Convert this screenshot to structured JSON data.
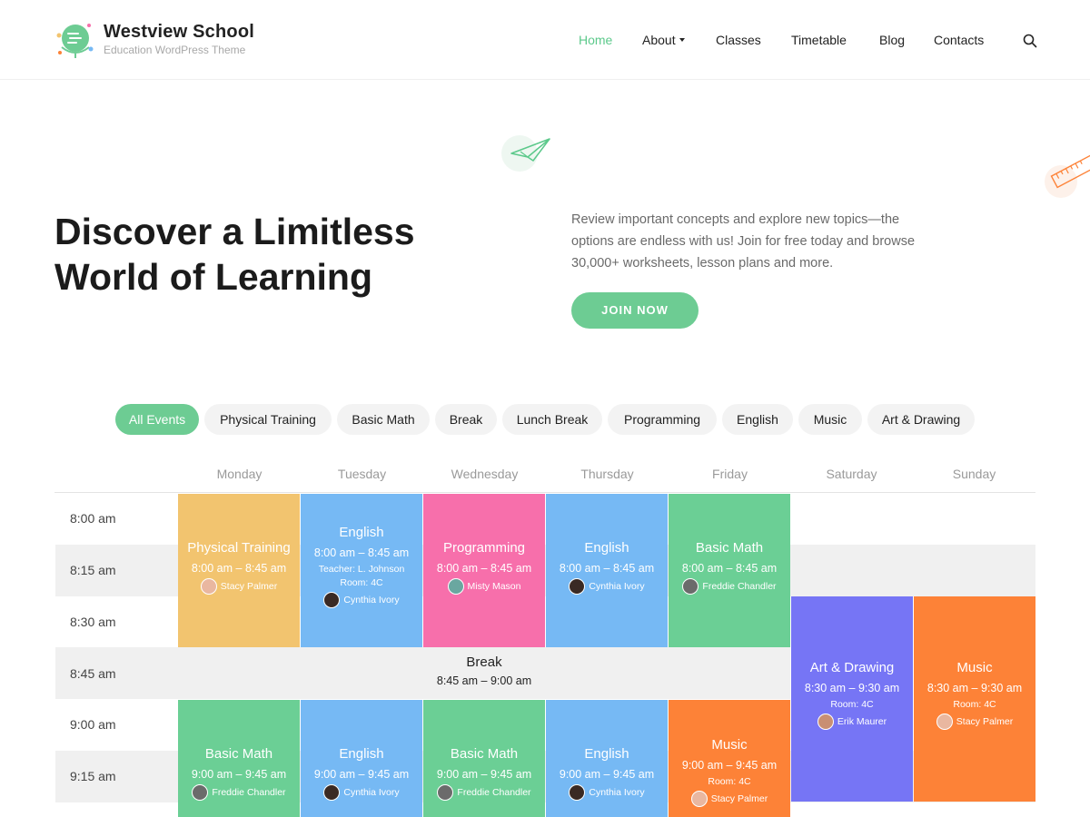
{
  "brand": {
    "title": "Westview School",
    "tagline": "Education WordPress Theme"
  },
  "nav": [
    {
      "label": "Home",
      "active": true
    },
    {
      "label": "About",
      "dropdown": true
    },
    {
      "label": "Classes"
    },
    {
      "label": "Timetable"
    },
    {
      "label": "Blog"
    },
    {
      "label": "Contacts"
    }
  ],
  "hero": {
    "title": "Discover a Limitless World of Learning",
    "text": "Review important concepts and explore new topics—the options are endless with us! Join for free today and browse 30,000+ worksheets, lesson plans and more.",
    "cta": "JOIN NOW"
  },
  "filters": [
    "All Events",
    "Physical Training",
    "Basic Math",
    "Break",
    "Lunch Break",
    "Programming",
    "English",
    "Music",
    "Art & Drawing"
  ],
  "days": [
    "Monday",
    "Tuesday",
    "Wednesday",
    "Thursday",
    "Friday",
    "Saturday",
    "Sunday"
  ],
  "times": [
    "8:00 am",
    "8:15 am",
    "8:30 am",
    "8:45 am",
    "9:00 am",
    "9:15 am"
  ],
  "events": [
    {
      "title": "Physical Training",
      "time": "8:00 am – 8:45 am",
      "person": "Stacy Palmer",
      "color": "#f2c46f"
    },
    {
      "title": "English",
      "time": "8:00 am – 8:45 am",
      "teacher": "Teacher: L. Johnson",
      "room": "Room: 4C",
      "person": "Cynthia Ivory",
      "color": "#76b9f4"
    },
    {
      "title": "Programming",
      "time": "8:00 am – 8:45 am",
      "person": "Misty Mason",
      "color": "#f76fab"
    },
    {
      "title": "English",
      "time": "8:00 am – 8:45 am",
      "person": "Cynthia Ivory",
      "color": "#76b9f4"
    },
    {
      "title": "Basic Math",
      "time": "8:00 am – 8:45 am",
      "person": "Freddie Chandler",
      "color": "#6bcf95"
    },
    {
      "title": "Art & Drawing",
      "time": "8:30 am – 9:30 am",
      "room": "Room: 4C",
      "person": "Erik Maurer",
      "color": "#7675f5"
    },
    {
      "title": "Music",
      "time": "8:30 am – 9:30 am",
      "room": "Room: 4C",
      "person": "Stacy Palmer",
      "color": "#fd8237"
    },
    {
      "title": "Break",
      "time": "8:45 am – 9:00 am"
    },
    {
      "title": "Basic Math",
      "time": "9:00 am – 9:45 am",
      "person": "Freddie Chandler",
      "color": "#6bcf95"
    },
    {
      "title": "English",
      "time": "9:00 am – 9:45 am",
      "person": "Cynthia Ivory",
      "color": "#76b9f4"
    },
    {
      "title": "Basic Math",
      "time": "9:00 am – 9:45 am",
      "person": "Freddie Chandler",
      "color": "#6bcf95"
    },
    {
      "title": "English",
      "time": "9:00 am – 9:45 am",
      "person": "Cynthia Ivory",
      "color": "#76b9f4"
    },
    {
      "title": "Music",
      "time": "9:00 am – 9:45 am",
      "room": "Room: 4C",
      "person": "Stacy Palmer",
      "color": "#fd8237"
    }
  ]
}
